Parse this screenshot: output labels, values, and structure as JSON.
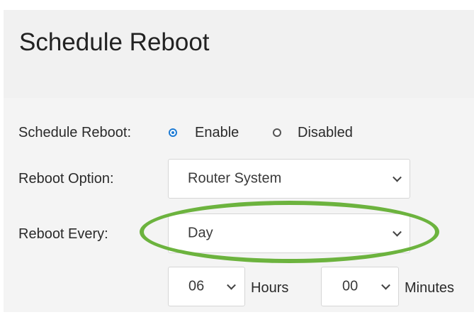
{
  "header": {
    "title": "Schedule Reboot"
  },
  "form": {
    "schedule": {
      "label": "Schedule Reboot:",
      "options": [
        {
          "label": "Enable",
          "selected": true
        },
        {
          "label": "Disabled",
          "selected": false
        }
      ]
    },
    "reboot_option": {
      "label": "Reboot Option:",
      "value": "Router System"
    },
    "reboot_every": {
      "label": "Reboot Every:",
      "value": "Day"
    },
    "time": {
      "hours_value": "06",
      "hours_label": "Hours",
      "minutes_value": "00",
      "minutes_label": "Minutes"
    }
  },
  "icons": {
    "dropdown": "chevron-down-icon",
    "radio_selected": "radio-checked-icon",
    "radio_unselected": "radio-unchecked-icon"
  },
  "colors": {
    "accent": "#1e7bd4",
    "highlight": "#6cb33e",
    "header_bg": "#f1f1f1",
    "panel_bg": "#f4f4f4"
  }
}
